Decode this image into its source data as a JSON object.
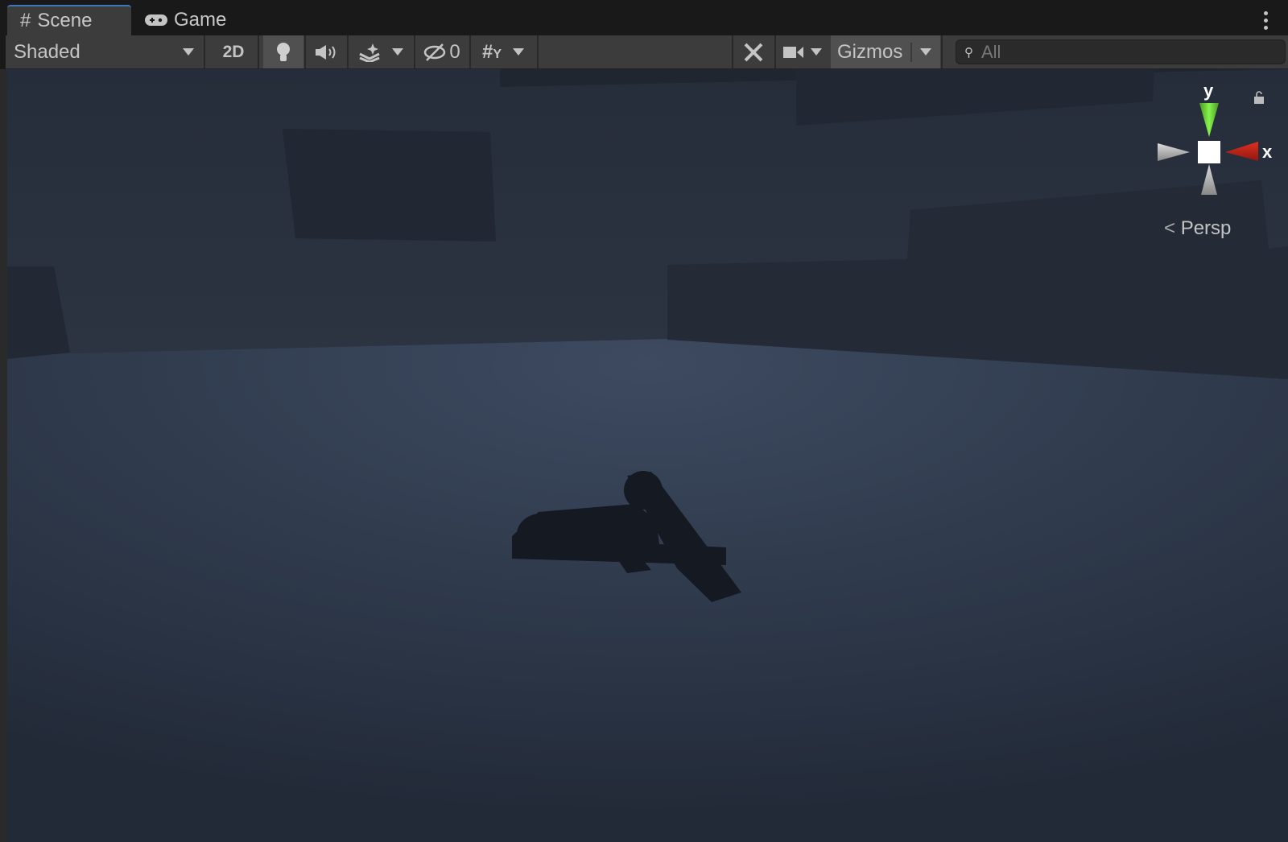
{
  "tabs": [
    {
      "label": "Scene",
      "icon": "scene-grid-icon"
    },
    {
      "label": "Game",
      "icon": "gamepad-icon"
    }
  ],
  "toolbar": {
    "shading_mode": "Shaded",
    "toggle_2d": "2D",
    "hidden_count": "0",
    "gizmos_label": "Gizmos",
    "search_placeholder": "All"
  },
  "gizmo": {
    "y_label": "y",
    "x_label": "x",
    "projection": "Persp"
  },
  "colors": {
    "accent": "#3a79bb",
    "y_axis": "#76e043",
    "x_axis": "#c8231c"
  }
}
